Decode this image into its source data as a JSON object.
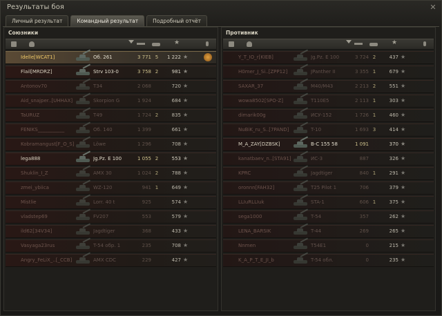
{
  "window": {
    "title": "Результаты боя"
  },
  "tabs": [
    {
      "label": "Личный результат",
      "active": false
    },
    {
      "label": "Командный результат",
      "active": true
    },
    {
      "label": "Подробный отчёт",
      "active": false
    }
  ],
  "allies": {
    "title": "Союзники",
    "rows": [
      {
        "name": "Idelle[WCAT1]",
        "tank": "Об. 261",
        "damage": "3 771",
        "kills": "5",
        "xp": "1 222",
        "me": true,
        "alive": true,
        "medal": true
      },
      {
        "name": "Flail[MRDRZ]",
        "tank": "Strv 103-0",
        "damage": "3 758",
        "kills": "2",
        "xp": "981",
        "alive": true
      },
      {
        "name": "Antonov70",
        "tank": "T34",
        "damage": "2 068",
        "kills": "",
        "xp": "720",
        "alive": false
      },
      {
        "name": "Aid_snajper..[UHHAX]",
        "tank": "Skorpion G",
        "damage": "1 924",
        "kills": "",
        "xp": "684",
        "alive": false
      },
      {
        "name": "TaURUZ",
        "tank": "T49",
        "damage": "1 724",
        "kills": "2",
        "xp": "835",
        "alive": false
      },
      {
        "name": "FENIKS___________",
        "tank": "Об. 140",
        "damage": "1 399",
        "kills": "",
        "xp": "661",
        "alive": false
      },
      {
        "name": "Kobramangust[F_O_S]",
        "tank": "Löwe",
        "damage": "1 296",
        "kills": "",
        "xp": "708",
        "alive": false
      },
      {
        "name": "lega888",
        "tank": "Jg.Pz. E 100",
        "damage": "1 055",
        "kills": "2",
        "xp": "553",
        "alive": true
      },
      {
        "name": "Shuklin_I_Z",
        "tank": "AMX 30",
        "damage": "1 024",
        "kills": "2",
        "xp": "788",
        "alive": false
      },
      {
        "name": "zmei_ybiica",
        "tank": "WZ-120",
        "damage": "941",
        "kills": "1",
        "xp": "649",
        "alive": false
      },
      {
        "name": "Mistlie",
        "tank": "Lorr. 40 t",
        "damage": "925",
        "kills": "",
        "xp": "574",
        "alive": false
      },
      {
        "name": "vladstep69",
        "tank": "FV207",
        "damage": "553",
        "kills": "",
        "xp": "579",
        "alive": false
      },
      {
        "name": "ild62[34V34]",
        "tank": "Jagdtiger",
        "damage": "368",
        "kills": "",
        "xp": "433",
        "alive": false
      },
      {
        "name": "Vasyaga23rus",
        "tank": "T-54 обр. 1",
        "damage": "235",
        "kills": "",
        "xp": "708",
        "alive": false
      },
      {
        "name": "Angry_FeLiX_..[_CCB]",
        "tank": "AMX CDC",
        "damage": "229",
        "kills": "",
        "xp": "427",
        "alive": false
      }
    ]
  },
  "enemies": {
    "title": "Противник",
    "rows": [
      {
        "name": "Y_T_IO_r[KIEB]",
        "tank": "Jg.Pz. E 100",
        "damage": "3 724",
        "kills": "2",
        "xp": "437",
        "alive": false
      },
      {
        "name": "H0mer_J_Si..[ZPP12]",
        "tank": "JPanther II",
        "damage": "3 355",
        "kills": "1",
        "xp": "679",
        "alive": false
      },
      {
        "name": "SAXAR_37",
        "tank": "M40/M43",
        "damage": "2 213",
        "kills": "2",
        "xp": "551",
        "alive": false
      },
      {
        "name": "wowa8502[SPO-Z]",
        "tank": "T110E5",
        "damage": "2 113",
        "kills": "1",
        "xp": "303",
        "alive": false
      },
      {
        "name": "dimarik00g",
        "tank": "ИСУ-152",
        "damage": "1 726",
        "kills": "1",
        "xp": "460",
        "alive": false
      },
      {
        "name": "NuBiK_ru_S..[7PAND]",
        "tank": "T-10",
        "damage": "1 693",
        "kills": "3",
        "xp": "414",
        "alive": false
      },
      {
        "name": "M_A_ZAY[DZBSK]",
        "tank": "B-C 155 58",
        "damage": "1 091",
        "kills": "",
        "xp": "370",
        "alive": true,
        "highlight": true
      },
      {
        "name": "kanatbaev_n..[STA91]",
        "tank": "ИС-3",
        "damage": "887",
        "kills": "",
        "xp": "326",
        "alive": false
      },
      {
        "name": "KPRC",
        "tank": "Jagdtiger",
        "damage": "840",
        "kills": "1",
        "xp": "291",
        "alive": false
      },
      {
        "name": "oronnn[FAH32]",
        "tank": "T25 Pilot 1",
        "damage": "706",
        "kills": "",
        "xp": "379",
        "alive": false
      },
      {
        "name": "LLIuRLLIuk",
        "tank": "STA-1",
        "damage": "606",
        "kills": "1",
        "xp": "375",
        "alive": false
      },
      {
        "name": "sega1000",
        "tank": "T-54",
        "damage": "357",
        "kills": "",
        "xp": "262",
        "alive": false
      },
      {
        "name": "LENA_BARSIK",
        "tank": "T-44",
        "damage": "269",
        "kills": "",
        "xp": "265",
        "alive": false
      },
      {
        "name": "Nnmen",
        "tank": "T54E1",
        "damage": "0",
        "kills": "",
        "xp": "215",
        "alive": false
      },
      {
        "name": "K_A_P_T_E_JI_b",
        "tank": "T-54 обл.",
        "damage": "0",
        "kills": "",
        "xp": "235",
        "alive": false
      }
    ]
  },
  "colors": {
    "accent": "#f0c968",
    "dead": "#7b5d55",
    "alive": "#d9d2c0"
  },
  "icons": [
    "close-icon",
    "squad-icon",
    "player-icon",
    "sort-arrow-icon",
    "gun-icon",
    "tank-icon",
    "star-icon",
    "status-icon",
    "medal-icon"
  ]
}
